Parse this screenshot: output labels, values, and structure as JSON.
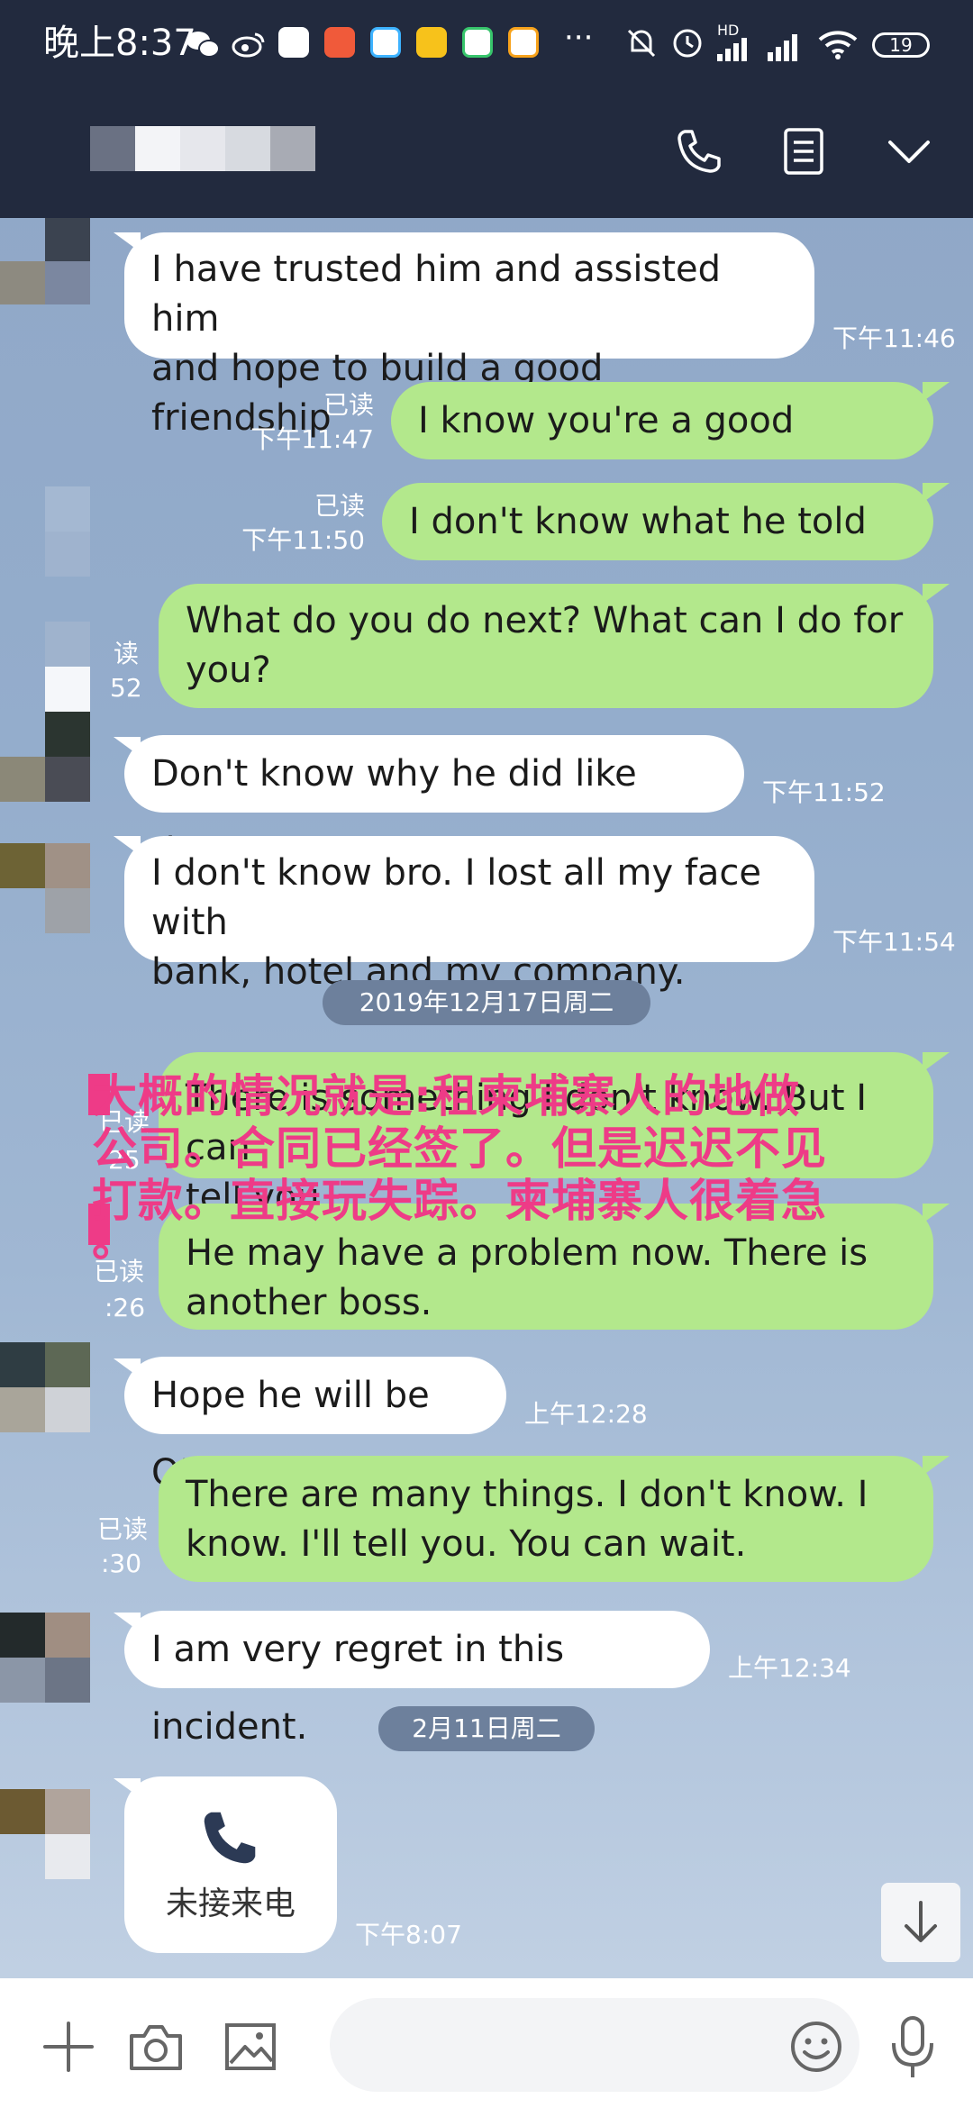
{
  "status_bar": {
    "time": "晚上8:37",
    "more": "···",
    "battery": "19",
    "network": "HD"
  },
  "header": {
    "title": ""
  },
  "messages": [
    {
      "line1": "I have trusted him and assisted him",
      "line2": "and hope to build a good friendship",
      "time": "下午11:46"
    },
    {
      "text": "I know you're a good person.",
      "read": "已读",
      "time": "下午11:47"
    },
    {
      "text": "I don't know what he told you.",
      "read": "已读",
      "time": "下午11:50"
    },
    {
      "line1": "What do you do next? What can I do for",
      "line2": "you?",
      "read": "读",
      "time": "52"
    },
    {
      "text": "Don't know why he did like that??",
      "time": "下午11:52"
    },
    {
      "line1": "I don't know bro. I lost all my face with",
      "line2": "bank, hotel and my company.",
      "time": "下午11:54"
    },
    {
      "line1": "There is something I don't know. But I can",
      "line2": "tell you.",
      "read": "已读",
      "time": "25"
    },
    {
      "line1": "He may have a problem now. There is",
      "line2": "another boss.",
      "read": "已读",
      "time": ":26"
    },
    {
      "text": "Hope he will be OK",
      "time": "上午12:28"
    },
    {
      "line1": "There are many things. I don't know. I",
      "line2": "know. I'll tell you. You can wait.",
      "read": "已读",
      "time": ":30"
    },
    {
      "text": "I am very regret in this incident.",
      "time": "上午12:34"
    },
    {
      "call_label": "未接来电",
      "time": "下午8:07"
    }
  ],
  "dates": {
    "d1": "2019年12月17日周二",
    "d2": "2月11日周二"
  },
  "overlay": {
    "line1": "大概的情况就是:租柬埔寨人的地做",
    "line2": "公司。合同已经签了。但是迟迟不见",
    "line3": "打款。直接玩失踪。柬埔寨人很着急",
    "line4": "。"
  },
  "colors": {
    "header": "#222a3e",
    "outgoing_bubble": "#b3e88c",
    "incoming_bubble": "#ffffff",
    "overlay_text": "#ee3b87",
    "date_pill": "#6d809c"
  }
}
